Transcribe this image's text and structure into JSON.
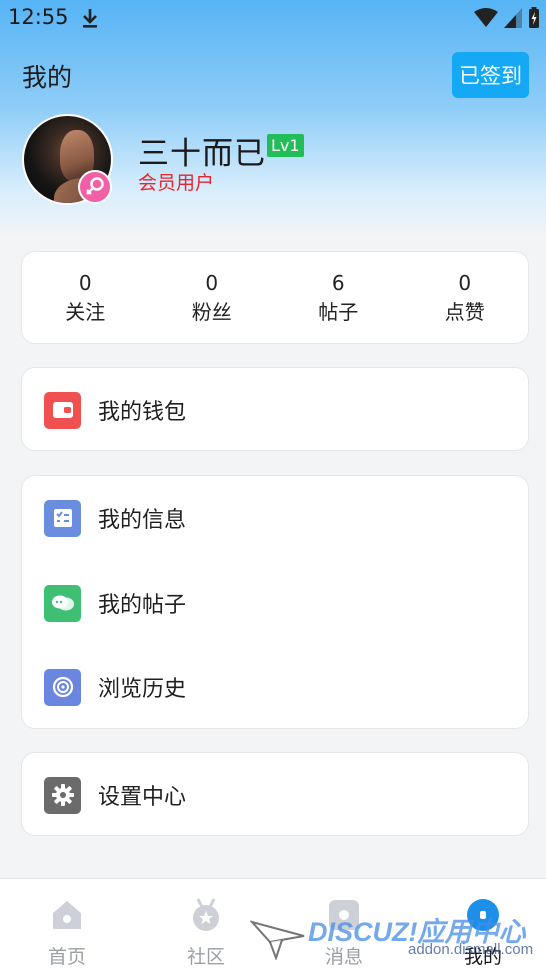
{
  "status_bar": {
    "time": "12:55"
  },
  "header": {
    "title": "我的",
    "checkin_label": "已签到"
  },
  "profile": {
    "username": "三十而已",
    "level": "Lv1",
    "role": "会员用户"
  },
  "stats": [
    {
      "value": "0",
      "label": "关注"
    },
    {
      "value": "0",
      "label": "粉丝"
    },
    {
      "value": "6",
      "label": "帖子"
    },
    {
      "value": "0",
      "label": "点赞"
    }
  ],
  "menu": {
    "wallet": "我的钱包",
    "info": "我的信息",
    "posts": "我的帖子",
    "history": "浏览历史",
    "settings": "设置中心"
  },
  "tabs": [
    {
      "label": "首页",
      "icon": "home-icon"
    },
    {
      "label": "社区",
      "icon": "medal-icon"
    },
    {
      "label": "消息",
      "icon": "message-icon"
    },
    {
      "label": "我的",
      "icon": "profile-icon",
      "active": true
    }
  ],
  "watermark": {
    "brand": "DISCUZ!应用中心",
    "domain": "addon.dismall.com"
  },
  "colors": {
    "accent": "#14a8f5",
    "level_badge": "#22bd59",
    "member_red": "#e8262f",
    "wallet_icon": "#f05050",
    "info_icon": "#6b8de0",
    "posts_icon": "#3fbf73",
    "history_icon": "#6a86e0",
    "settings_icon": "#6b6b6b"
  }
}
